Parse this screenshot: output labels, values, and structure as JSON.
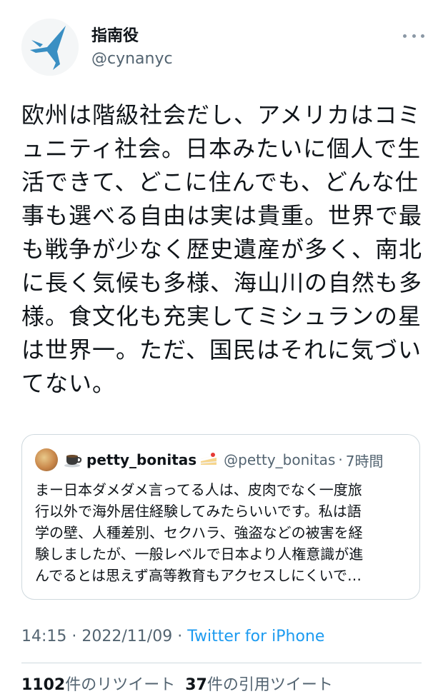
{
  "author": {
    "display_name": "指南役",
    "handle": "@cynanyc",
    "avatar_icon": "paper-plane-logo-avatar"
  },
  "more_icon": "more-dots-icon",
  "tweet": {
    "lines": [
      "欧州は階級社会だし、アメリカはコミ",
      "ュニティ社会。日本みたいに個人で生",
      "活できて、どこに住んでも、どんな仕",
      "事も選べる自由は実は貴重。世界で最",
      "も戦争が少なく歴史遺産が多く、南北",
      "に長く気候も多様、海山川の自然も多",
      "様。食文化も充実してミシュランの星",
      "は世界一。ただ、国民はそれに気づい",
      "てない。"
    ]
  },
  "quote": {
    "name": "petty_bonitas",
    "handle": "@petty_bonitas",
    "separator": "·",
    "time": "7時間",
    "name_prefix_icon": "coffee-cup-icon",
    "name_suffix_icon": "shortcake-icon",
    "lines": [
      "まー日本ダメダメ言ってる人は、皮肉でなく一度旅",
      "行以外で海外居住経験してみたらいいです。私は語",
      "学の壁、人種差別、セクハラ、強盗などの被害を経",
      "験しましたが、一般レベルで日本より人権意識が進",
      "んでるとは思えず高等教育もアクセスしにくいで…"
    ]
  },
  "meta": {
    "time": "14:15",
    "separator": " · ",
    "date": "2022/11/09",
    "separator2": " · ",
    "source": "Twitter for iPhone"
  },
  "stats": {
    "retweets_count": "1102",
    "retweets_label": "件のリツイート",
    "quotes_count": "37",
    "quotes_label": "件の引用ツイート"
  },
  "colors": {
    "link": "#1d9bf0",
    "secondary_text": "#536471",
    "border": "#cfd9de",
    "logo_blue": "#3a8fc3"
  }
}
